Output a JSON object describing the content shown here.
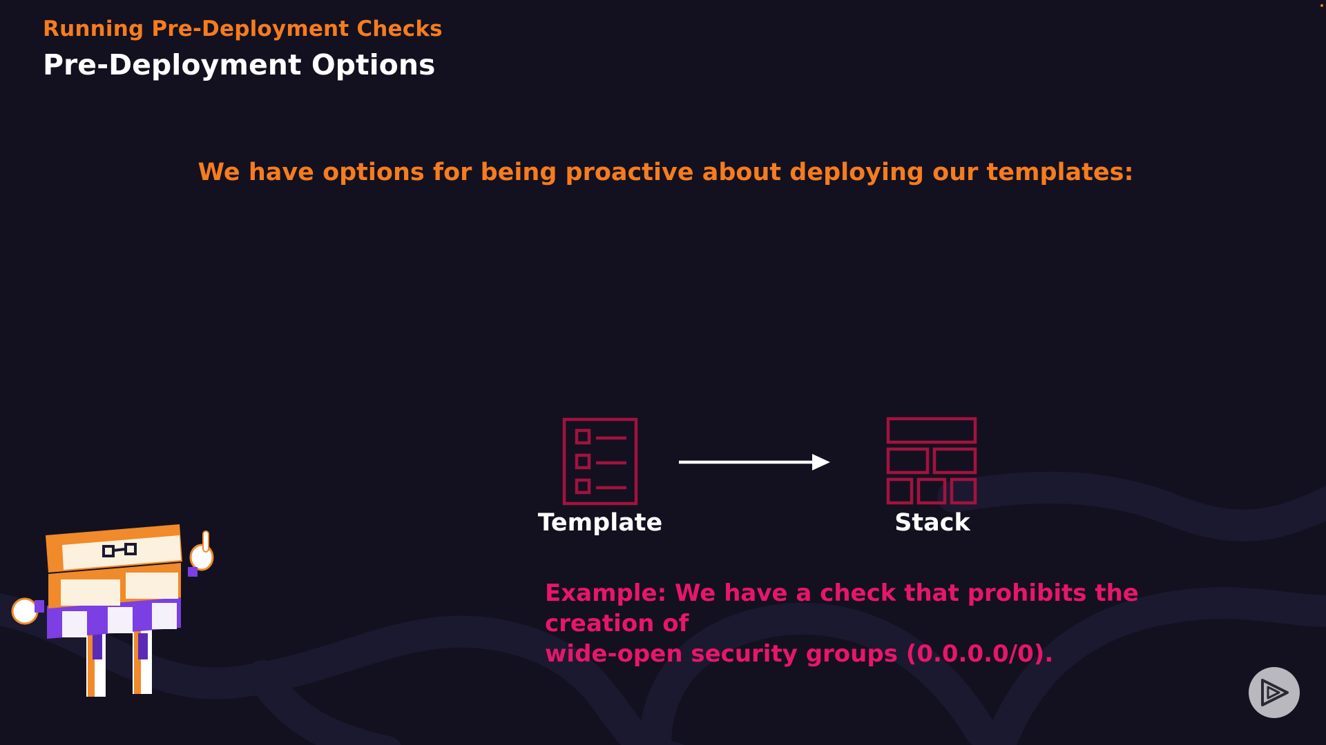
{
  "header": {
    "subtitle": "Running Pre-Deployment Checks",
    "title": "Pre-Deployment Options"
  },
  "main": {
    "intro": "We have options for being proactive about deploying our templates:",
    "flow": {
      "source_label": "Template",
      "target_label": "Stack"
    },
    "example": {
      "line1": "Example: We have a check that prohibits the creation of",
      "line2": "wide-open security groups (0.0.0.0/0)."
    }
  },
  "colors": {
    "background": "#13111f",
    "accent_orange": "#f57c1f",
    "accent_pink": "#e8166a",
    "icon_crimson": "#a3123f"
  },
  "icons": {
    "template": "checklist-icon",
    "stack": "stack-grid-icon",
    "arrow": "right-arrow-icon",
    "player": "play-logo-icon"
  }
}
